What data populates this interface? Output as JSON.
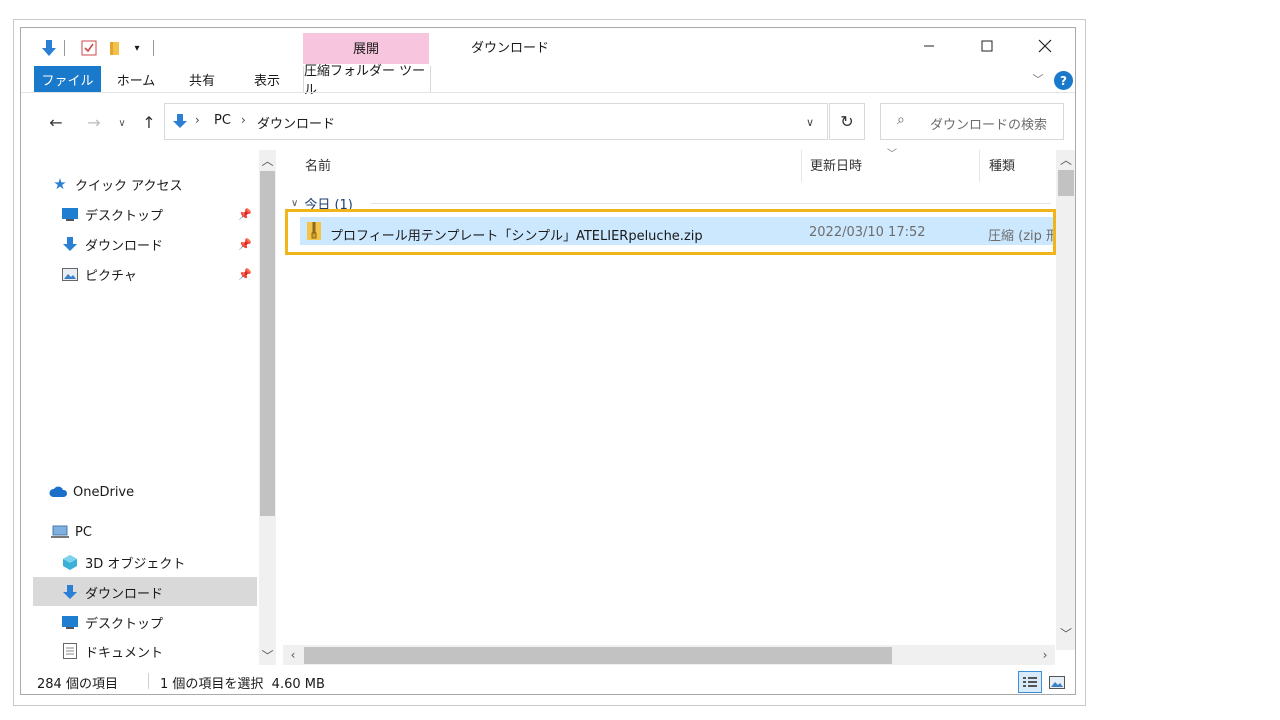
{
  "window": {
    "title": "ダウンロード",
    "minimize_icon": "minimize-icon",
    "maximize_icon": "maximize-icon",
    "close_icon": "close-icon"
  },
  "quick_access_toolbar": {
    "items": [
      "download-arrow-icon",
      "properties-check-icon",
      "new-folder-icon",
      "customize-dropdown-icon"
    ]
  },
  "ribbon": {
    "context_group_label": "展開",
    "context_group_color": "#f7c6de",
    "tabs": [
      "ファイル",
      "ホーム",
      "共有",
      "表示",
      "圧縮フォルダー ツール"
    ],
    "file_tab_color": "#1979ca",
    "help_label": "?"
  },
  "address_bar": {
    "breadcrumb": [
      "PC",
      "ダウンロード"
    ],
    "search_placeholder": "ダウンロードの検索"
  },
  "nav_pane": {
    "quick_access_label": "クイック アクセス",
    "quick_items": [
      {
        "label": "デスクトップ",
        "icon": "desktop-icon",
        "pinned": true
      },
      {
        "label": "ダウンロード",
        "icon": "download-icon",
        "pinned": true
      },
      {
        "label": "ピクチャ",
        "icon": "pictures-icon",
        "pinned": true
      }
    ],
    "onedrive_label": "OneDrive",
    "pc_label": "PC",
    "pc_items": [
      {
        "label": "3D オブジェクト",
        "icon": "3d-objects-icon",
        "selected": false
      },
      {
        "label": "ダウンロード",
        "icon": "download-icon",
        "selected": true
      },
      {
        "label": "デスクトップ",
        "icon": "desktop-icon",
        "selected": false
      },
      {
        "label": "ドキュメント",
        "icon": "documents-icon",
        "selected": false
      }
    ]
  },
  "columns": {
    "name": "名前",
    "modified": "更新日時",
    "type": "種類"
  },
  "group": {
    "label": "今日 (1)"
  },
  "files": [
    {
      "name": "プロフィール用テンプレート「シンプル」ATELIERpeluche.zip",
      "modified": "2022/03/10 17:52",
      "type": "圧縮 (zip 形",
      "selected": true,
      "highlight_color": "#f0b619"
    }
  ],
  "status_bar": {
    "item_count": "284 個の項目",
    "selection": "1 個の項目を選択  4.60 MB"
  }
}
